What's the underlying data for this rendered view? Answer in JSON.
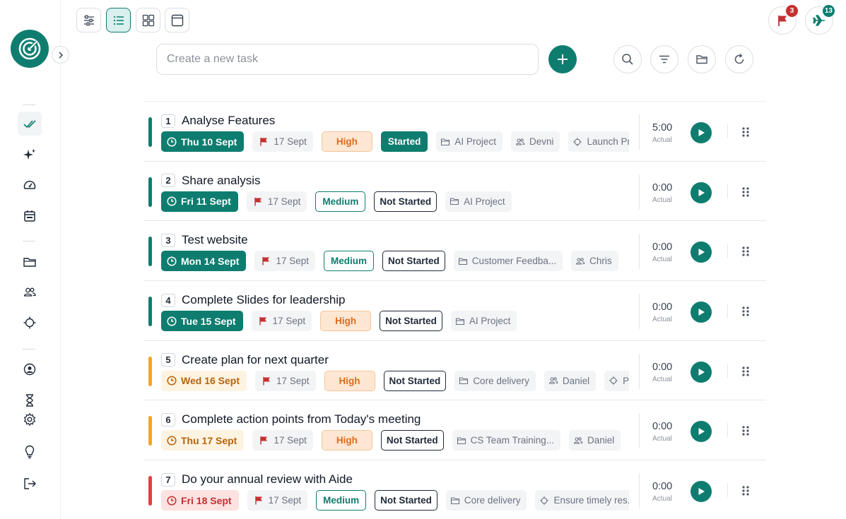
{
  "toolbar": {
    "views": [
      {
        "name": "view-settings-button",
        "icon": "sliders-icon",
        "active": false
      },
      {
        "name": "view-list-button",
        "icon": "list-icon",
        "active": true
      },
      {
        "name": "view-grid-button",
        "icon": "grid-icon",
        "active": false
      },
      {
        "name": "view-window-button",
        "icon": "window-icon",
        "active": false
      }
    ]
  },
  "task_input": {
    "placeholder": "Create a new task",
    "value": ""
  },
  "notifications": {
    "flags_count": "3",
    "flights_count": "13",
    "flags_badge_color": "#c53030",
    "flights_badge_color": "#0e7d6f"
  },
  "colors": {
    "accent": "#0e7d6f",
    "amber": "#f5a623",
    "red": "#e53e3e"
  },
  "tasks": [
    {
      "num": "1",
      "title": "Analyse Features",
      "date": "Thu 10 Sept",
      "date_style": "green",
      "flag_date": "17 Sept",
      "priority": "High",
      "status": "Started",
      "meta": [
        {
          "icon": "folder-icon",
          "text": "AI Project"
        },
        {
          "icon": "users-icon",
          "text": "Devni"
        },
        {
          "icon": "target-icon",
          "text": "Launch Product"
        }
      ],
      "time": "5:00",
      "time_label": "Actual"
    },
    {
      "num": "2",
      "title": "Share analysis",
      "date": "Fri 11 Sept",
      "date_style": "green",
      "flag_date": "17 Sept",
      "priority": "Medium",
      "status": "Not Started",
      "meta": [
        {
          "icon": "folder-icon",
          "text": "AI Project"
        }
      ],
      "time": "0:00",
      "time_label": "Actual"
    },
    {
      "num": "3",
      "title": "Test website",
      "date": "Mon 14 Sept",
      "date_style": "green",
      "flag_date": "17 Sept",
      "priority": "Medium",
      "status": "Not Started",
      "meta": [
        {
          "icon": "folder-icon",
          "text": "Customer Feedba..."
        },
        {
          "icon": "users-icon",
          "text": "Chris"
        }
      ],
      "time": "0:00",
      "time_label": "Actual"
    },
    {
      "num": "4",
      "title": "Complete Slides for leadership",
      "date": "Tue 15 Sept",
      "date_style": "green",
      "flag_date": "17 Sept",
      "priority": "High",
      "status": "Not Started",
      "meta": [
        {
          "icon": "folder-icon",
          "text": "AI Project"
        }
      ],
      "time": "0:00",
      "time_label": "Actual"
    },
    {
      "num": "5",
      "title": "Create plan for next quarter",
      "date": "Wed 16 Sept",
      "date_style": "amber",
      "flag_date": "17 Sept",
      "priority": "High",
      "status": "Not Started",
      "meta": [
        {
          "icon": "folder-icon",
          "text": "Core delivery"
        },
        {
          "icon": "users-icon",
          "text": "Daniel"
        },
        {
          "icon": "target-icon",
          "text": "Position"
        }
      ],
      "time": "0:00",
      "time_label": "Actual"
    },
    {
      "num": "6",
      "title": "Complete action points from Today's meeting",
      "date": "Thu 17 Sept",
      "date_style": "amber",
      "flag_date": "17 Sept",
      "priority": "High",
      "status": "Not Started",
      "meta": [
        {
          "icon": "folder-icon",
          "text": "CS Team Training..."
        },
        {
          "icon": "users-icon",
          "text": "Daniel"
        }
      ],
      "time": "0:00",
      "time_label": "Actual"
    },
    {
      "num": "7",
      "title": "Do your annual review with Aide",
      "date": "Fri 18 Sept",
      "date_style": "red",
      "flag_date": "17 Sept",
      "priority": "Medium",
      "status": "Not Started",
      "meta": [
        {
          "icon": "folder-icon",
          "text": "Core delivery"
        },
        {
          "icon": "target-icon",
          "text": "Ensure timely res..."
        }
      ],
      "time": "0:00",
      "time_label": "Actual"
    }
  ]
}
